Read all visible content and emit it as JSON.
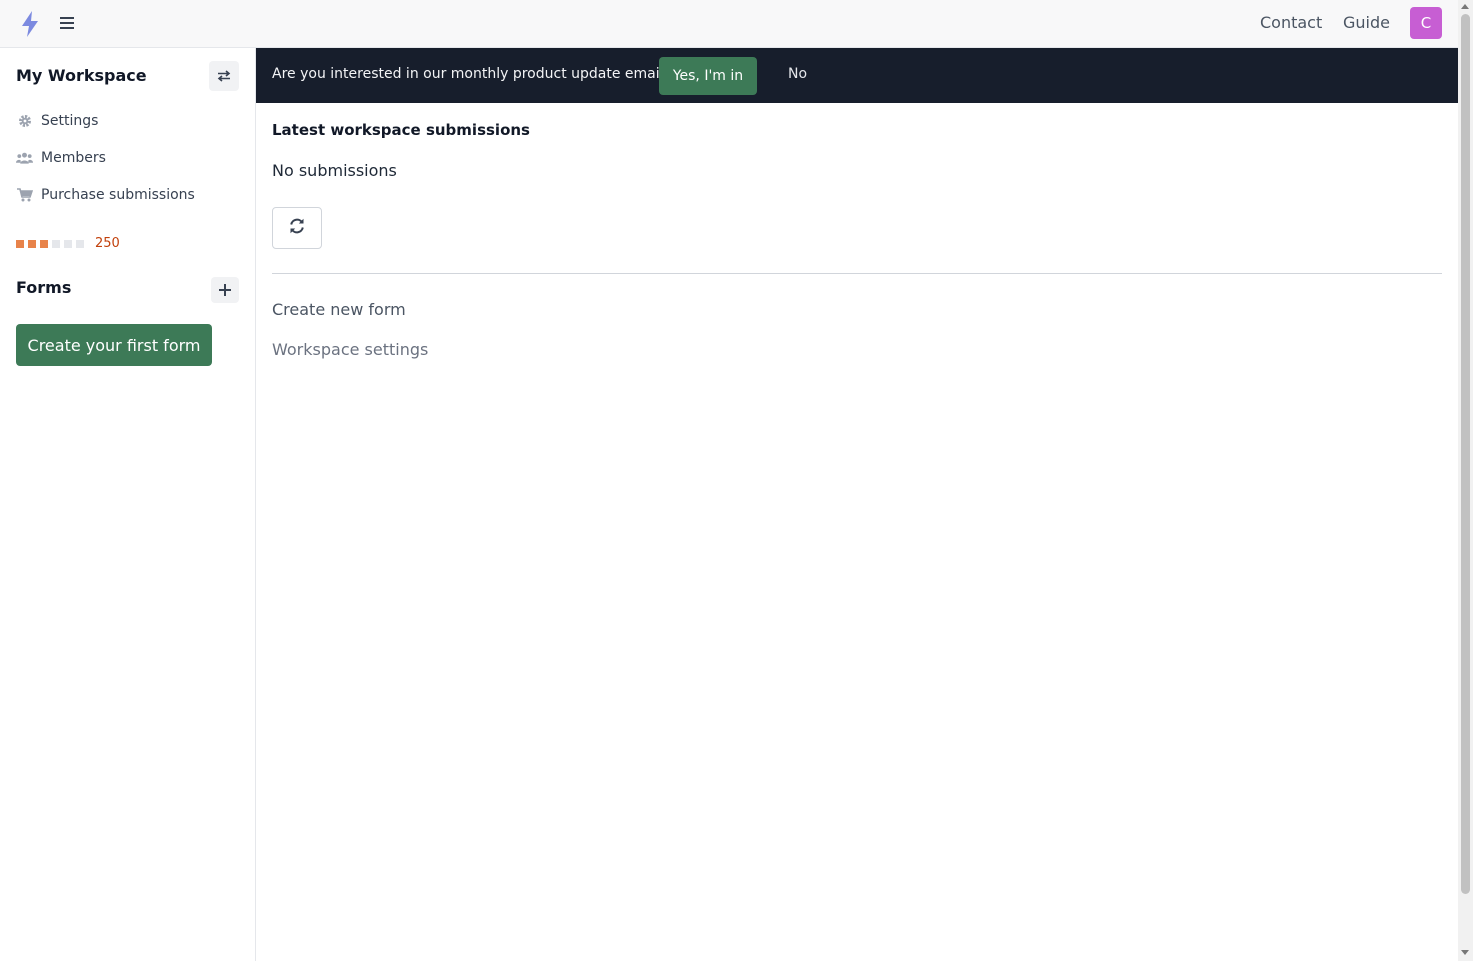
{
  "topbar": {
    "logo_icon": "lightning-bolt-icon",
    "menu_icon": "hamburger-icon",
    "links": [
      "Contact",
      "Guide"
    ],
    "avatar_initial": "C"
  },
  "sidebar": {
    "workspace_title": "My Workspace",
    "switch_icon": "swap-arrows-icon",
    "items": [
      {
        "label": "Settings",
        "icon": "gear-icon"
      },
      {
        "label": "Members",
        "icon": "users-icon"
      },
      {
        "label": "Purchase submissions",
        "icon": "cart-icon"
      }
    ],
    "meter": {
      "value": "250",
      "filled": 3,
      "total": 6
    },
    "forms_title": "Forms",
    "add_icon": "plus-icon",
    "create_button": "Create your first form"
  },
  "banner": {
    "question": "Are you interested in our monthly product update email?",
    "yes_label": "Yes, I'm in",
    "no_label": "No"
  },
  "main": {
    "latest_title": "Latest workspace submissions",
    "empty_text": "No submissions",
    "refresh_icon": "refresh-icon",
    "create_link": "Create new form",
    "settings_link": "Workspace settings"
  },
  "colors": {
    "accent_green": "#3d7a57",
    "banner_bg": "#171e2c",
    "avatar": "#c75ed3",
    "meter_fill": "#e8834a",
    "meter_empty": "#e5e7eb",
    "meter_value": "#c2410c"
  }
}
